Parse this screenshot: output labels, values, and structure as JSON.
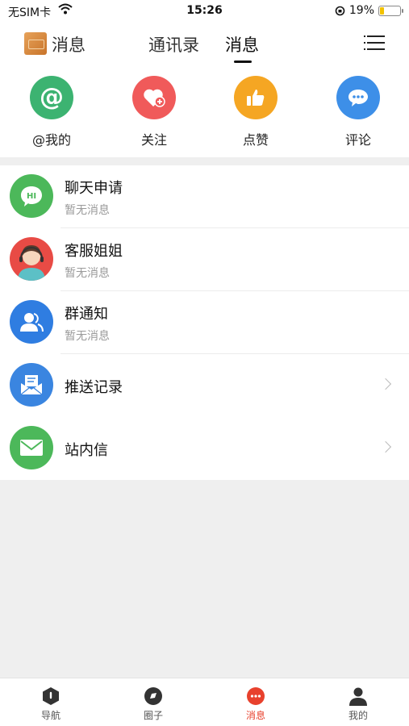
{
  "status_bar": {
    "carrier": "无SIM卡",
    "time": "15:26",
    "battery": "19%",
    "battery_level": 0.19
  },
  "top_nav": {
    "title": "消息",
    "tabs": [
      {
        "label": "通讯录"
      },
      {
        "label": "消息",
        "active": true
      }
    ],
    "menu_icon": "list-menu-icon"
  },
  "quick_actions": [
    {
      "label": "@我的",
      "icon": "at-icon",
      "color": "#3cb371"
    },
    {
      "label": "关注",
      "icon": "heart-plus-icon",
      "color": "#f05a5a"
    },
    {
      "label": "点赞",
      "icon": "thumbs-up-icon",
      "color": "#f5a623"
    },
    {
      "label": "评论",
      "icon": "speech-bubble-icon",
      "color": "#3d8fe8"
    }
  ],
  "messages": [
    {
      "title": "聊天申请",
      "subtitle": "暂无消息",
      "icon": "hi-bubble-icon",
      "color": "#4cb85a",
      "badge_text": "HI"
    },
    {
      "title": "客服姐姐",
      "subtitle": "暂无消息",
      "icon": "customer-service-avatar",
      "color": "#e84b45"
    },
    {
      "title": "群通知",
      "subtitle": "暂无消息",
      "icon": "group-icon",
      "color": "#2f7de1"
    },
    {
      "title": "推送记录",
      "icon": "push-envelope-icon",
      "color": "#3a85e0",
      "chevron": true
    },
    {
      "title": "站内信",
      "icon": "mail-icon",
      "color": "#4cb85a",
      "chevron": true
    }
  ],
  "tab_bar": [
    {
      "label": "导航",
      "icon": "nav-hexagon-icon"
    },
    {
      "label": "圈子",
      "icon": "circle-icon"
    },
    {
      "label": "消息",
      "icon": "message-dots-icon",
      "active": true,
      "active_color": "#e8412d"
    },
    {
      "label": "我的",
      "icon": "person-icon"
    }
  ]
}
